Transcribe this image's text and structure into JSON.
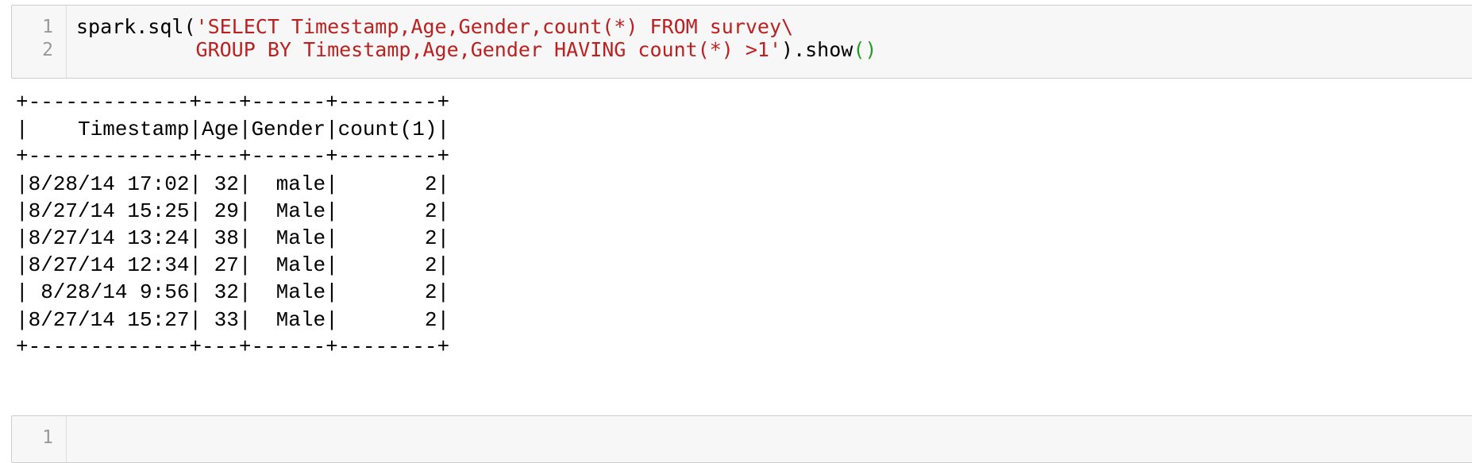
{
  "cell1": {
    "line_numbers": [
      "1",
      "2"
    ],
    "code": {
      "line1_prefix": "spark.sql(",
      "line1_string": "'SELECT Timestamp,Age,Gender,count(*) FROM survey\\",
      "line2_indent": "          ",
      "line2_string": "GROUP BY Timestamp,Age,Gender HAVING count(*) >1'",
      "line2_close": ").show",
      "line2_parens": "()"
    }
  },
  "output": {
    "border": "+-------------+---+------+--------+",
    "header": "|    Timestamp|Age|Gender|count(1)|",
    "rows": [
      "|8/28/14 17:02| 32|  male|       2|",
      "|8/27/14 15:25| 29|  Male|       2|",
      "|8/27/14 13:24| 38|  Male|       2|",
      "|8/27/14 12:34| 27|  Male|       2|",
      "| 8/28/14 9:56| 32|  Male|       2|",
      "|8/27/14 15:27| 33|  Male|       2|"
    ]
  },
  "cell2": {
    "line_numbers": [
      "1"
    ]
  }
}
